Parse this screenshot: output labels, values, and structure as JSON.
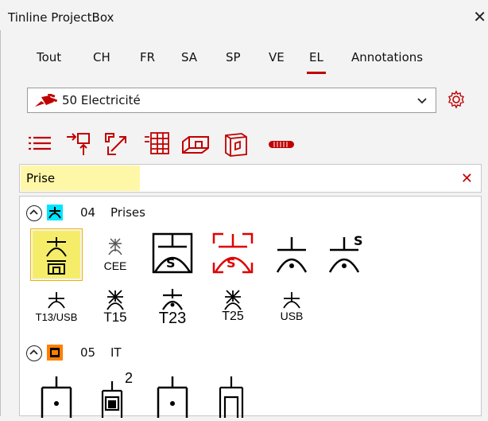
{
  "window": {
    "title": "Tinline ProjectBox",
    "close_glyph": "✕"
  },
  "tabs": [
    {
      "label": "Tout",
      "active": false
    },
    {
      "label": "CH",
      "active": false
    },
    {
      "label": "FR",
      "active": false
    },
    {
      "label": "SA",
      "active": false
    },
    {
      "label": "SP",
      "active": false
    },
    {
      "label": "VE",
      "active": false
    },
    {
      "label": "EL",
      "active": true
    },
    {
      "label": "Annotations",
      "active": false
    }
  ],
  "category": {
    "selected": "50 Electricité",
    "icon": "plug-icon"
  },
  "toolbar": [
    "list-icon",
    "insert-icon",
    "scale-arrows-icon",
    "grid-icon",
    "cabinet-icon",
    "box-icon",
    "cable-icon"
  ],
  "search": {
    "value": "Prise",
    "clear_glyph": "✕"
  },
  "groups": [
    {
      "number": "04",
      "name": "Prises",
      "icon_color": "#00e5ff",
      "items": [
        {
          "name": "prise-icon",
          "label": "",
          "selected": true
        },
        {
          "name": "cee-icon",
          "label": "CEE"
        },
        {
          "name": "socket-s-icon",
          "label": ""
        },
        {
          "name": "socket-s-red-icon",
          "label": ""
        },
        {
          "name": "socket-dot-icon",
          "label": ""
        },
        {
          "name": "socket-s-dot-icon",
          "label": ""
        },
        {
          "name": "t13-usb-icon",
          "label": "T13/USB"
        },
        {
          "name": "t15-icon",
          "label": "T15"
        },
        {
          "name": "t23-icon",
          "label": "T23"
        },
        {
          "name": "t25-icon",
          "label": "T25"
        },
        {
          "name": "usb-icon",
          "label": "USB"
        }
      ]
    },
    {
      "number": "05",
      "name": "IT",
      "icon_color": "#ff7f00",
      "items": [
        {
          "name": "it-socket-icon",
          "label": ""
        },
        {
          "name": "it-socket-2-icon",
          "label": "2"
        },
        {
          "name": "it-socket-dot-icon",
          "label": ""
        },
        {
          "name": "it-socket-frame-icon",
          "label": ""
        }
      ]
    }
  ],
  "colors": {
    "accent": "#c00000",
    "highlight": "#fff7a8",
    "selected": "#f5ed6a"
  }
}
